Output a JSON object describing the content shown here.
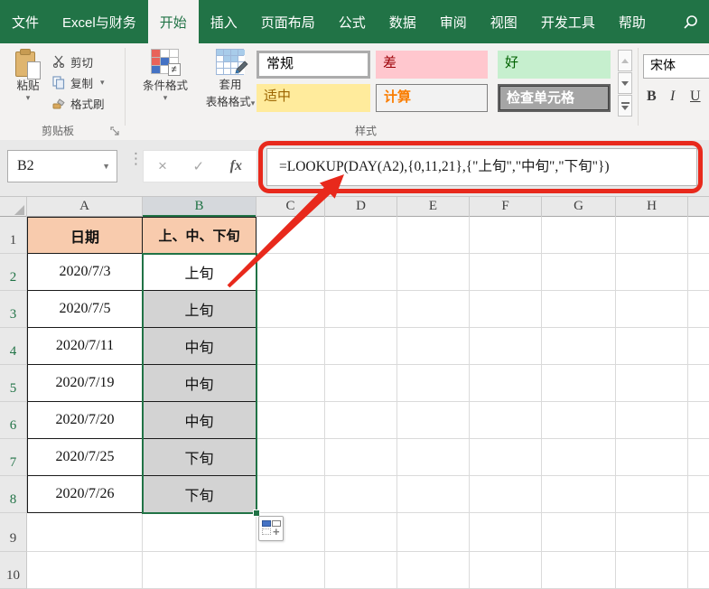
{
  "menubar": {
    "tabs": [
      {
        "label": "文件"
      },
      {
        "label": "Excel与财务"
      },
      {
        "label": "开始",
        "active": true
      },
      {
        "label": "插入"
      },
      {
        "label": "页面布局"
      },
      {
        "label": "公式"
      },
      {
        "label": "数据"
      },
      {
        "label": "审阅"
      },
      {
        "label": "视图"
      },
      {
        "label": "开发工具"
      },
      {
        "label": "帮助"
      }
    ]
  },
  "ribbon": {
    "clipboard_group": {
      "paste": "粘贴",
      "cut": "剪切",
      "copy": "复制",
      "format_painter": "格式刷",
      "label": "剪贴板"
    },
    "styles_group": {
      "conditional_formatting": "条件格式",
      "format_as_table_line1": "套用",
      "format_as_table_line2": "表格格式",
      "label": "样式",
      "cell_styles": [
        {
          "name": "常规",
          "bg": "#FFFFFF",
          "fg": "#000000"
        },
        {
          "name": "差",
          "bg": "#FFC7CE",
          "fg": "#9C0006"
        },
        {
          "name": "好",
          "bg": "#C6EFCE",
          "fg": "#006100"
        },
        {
          "name": "适中",
          "bg": "#FFEB9C",
          "fg": "#9C6500"
        },
        {
          "name": "计算",
          "bg": "#F2F2F2",
          "fg": "#FA7D00"
        },
        {
          "name": "检查单元格",
          "bg": "#A5A5A5",
          "fg": "#FFFFFF"
        }
      ]
    },
    "font_group": {
      "font_name": "宋体",
      "bold": "B",
      "italic": "I",
      "underline": "U"
    }
  },
  "formula_bar": {
    "name_box": "B2",
    "cancel": "×",
    "enter": "✓",
    "fx": "fx",
    "formula": "=LOOKUP(DAY(A2),{0,11,21},{\"上旬\",\"中旬\",\"下旬\"})"
  },
  "sheet": {
    "column_labels": [
      "A",
      "B",
      "C",
      "D",
      "E",
      "F",
      "G",
      "H"
    ],
    "row_labels": [
      "1",
      "2",
      "3",
      "4",
      "5",
      "6",
      "7",
      "8",
      "9",
      "10"
    ],
    "selected_column": "B",
    "active_cell": "B2",
    "selected_range": "B2:B8",
    "table": {
      "header_date": "日期",
      "header_period": "上、中、下旬",
      "rows": [
        {
          "date": "2020/7/3",
          "period": "上旬"
        },
        {
          "date": "2020/7/5",
          "period": "上旬"
        },
        {
          "date": "2020/7/11",
          "period": "中旬"
        },
        {
          "date": "2020/7/19",
          "period": "中旬"
        },
        {
          "date": "2020/7/20",
          "period": "中旬"
        },
        {
          "date": "2020/7/25",
          "period": "下旬"
        },
        {
          "date": "2020/7/26",
          "period": "下旬"
        }
      ]
    }
  },
  "colors": {
    "excel_green": "#217346",
    "annotation_red": "#E8291C",
    "table_header_bg": "#F8CBAD",
    "selection_fill": "#D3D3D3"
  }
}
